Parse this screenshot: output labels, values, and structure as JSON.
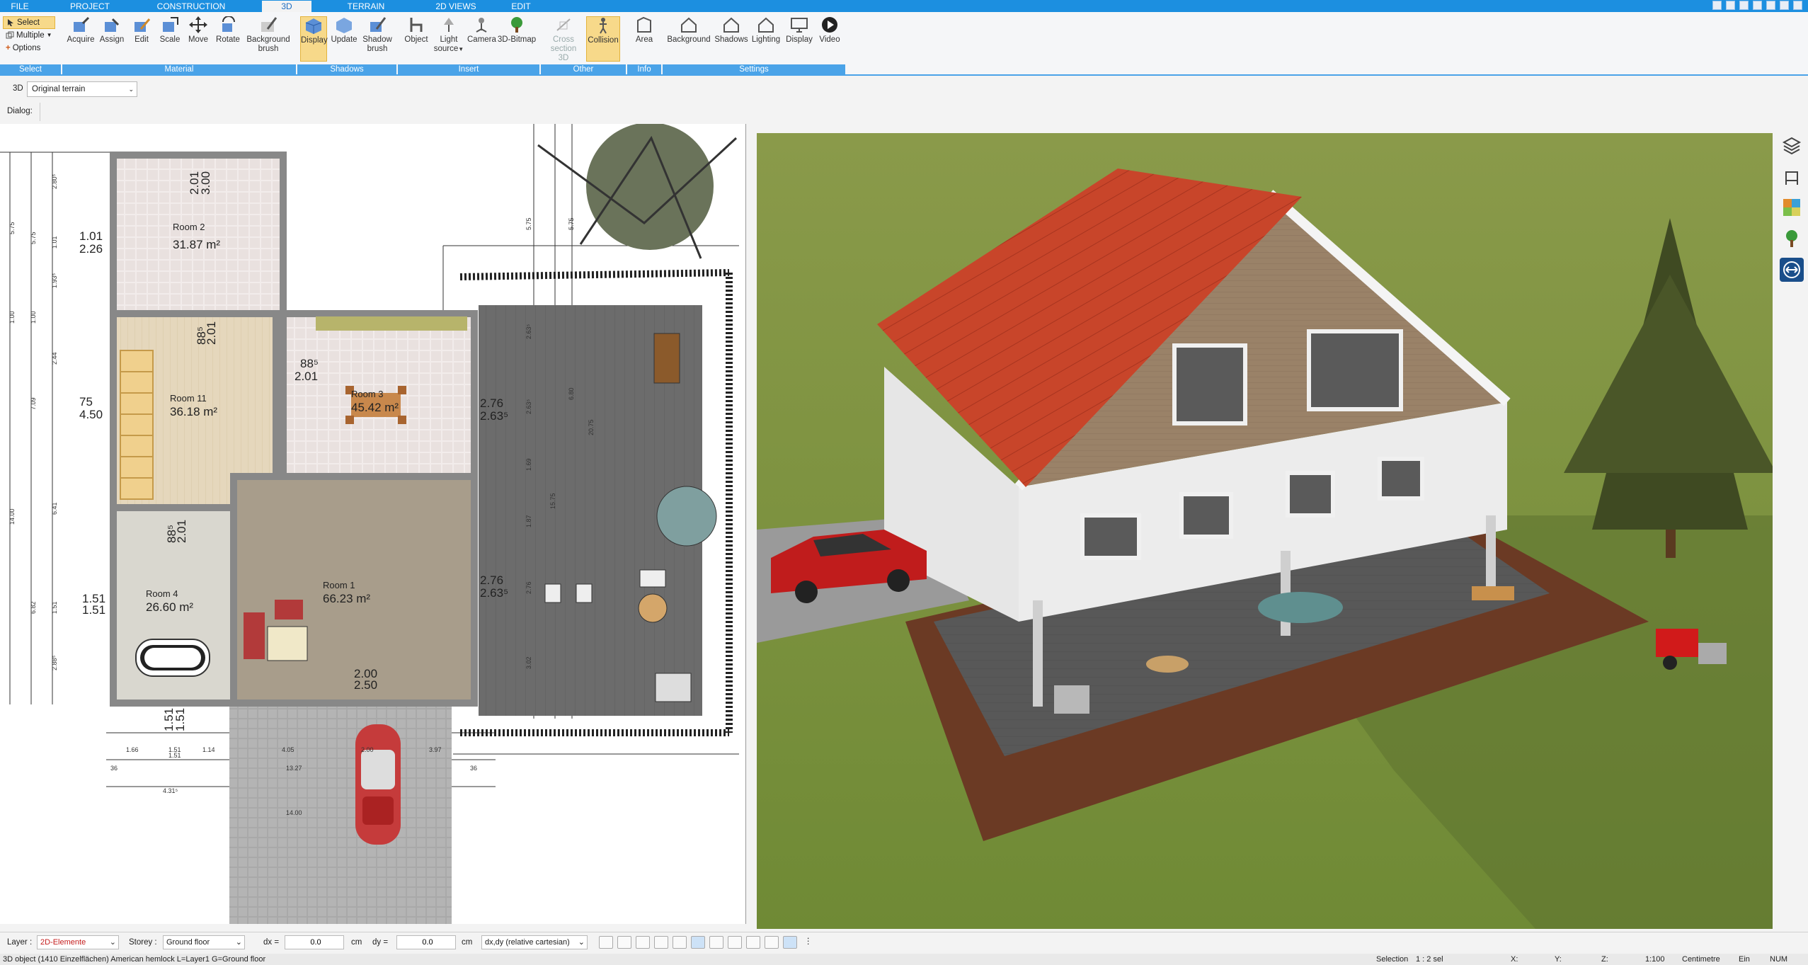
{
  "menu_tabs": [
    "FILE",
    "PROJECT",
    "CONSTRUCTION",
    "3D",
    "TERRAIN",
    "2D VIEWS",
    "EDIT"
  ],
  "active_tab": "3D",
  "ribbon": {
    "select_group": {
      "select": "Select",
      "multiple": "Multiple",
      "options": "Options",
      "label": "Select"
    },
    "material": {
      "label": "Material",
      "buttons": [
        "Acquire",
        "Assign",
        "Edit",
        "Scale",
        "Move",
        "Rotate",
        "Background brush"
      ]
    },
    "shadows": {
      "label": "Shadows",
      "buttons": [
        "Display",
        "Update",
        "Shadow brush"
      ]
    },
    "insert": {
      "label": "Insert",
      "buttons": [
        "Object",
        "Light source",
        "Camera",
        "3D-Bitmap"
      ]
    },
    "other": {
      "label": "Other",
      "buttons": [
        "Cross section 3D",
        "Collision"
      ]
    },
    "info": {
      "label": "Info",
      "buttons": [
        "Area"
      ]
    },
    "settings": {
      "label": "Settings",
      "buttons": [
        "Background",
        "Shadows",
        "Lighting",
        "Display",
        "Video"
      ]
    }
  },
  "subbar": {
    "mode": "3D",
    "terrain": "Original terrain",
    "dialog": "Dialog:"
  },
  "plan": {
    "rooms": [
      {
        "name": "Room 2",
        "area": "31.87 m²"
      },
      {
        "name": "Room 11",
        "area": "36.18 m²"
      },
      {
        "name": "Room 3",
        "area": "45.42 m²"
      },
      {
        "name": "Room 4",
        "area": "26.60 m²"
      },
      {
        "name": "Room 1",
        "area": "66.23 m²"
      }
    ],
    "dims": {
      "d1": "1.01",
      "d2": "2.26",
      "d3": "75",
      "d4": "4.50",
      "d5": "1.51",
      "d6": "1.51",
      "d7": "2.01",
      "d8": "3.00",
      "d9": "88⁵",
      "d10": "2.01",
      "d11": "88⁵",
      "d12": "2.01",
      "d13": "2.76",
      "d14": "2.63⁵",
      "d15": "2.76",
      "d16": "2.63⁵",
      "d17": "88⁵",
      "d18": "2.01",
      "d19": "2.00",
      "d20": "2.50",
      "d21": "1.51",
      "d22": "1.51",
      "d23": "2.00",
      "b1": "1.66",
      "b2": "1.51",
      "b3": "1.51",
      "b4": "1.14",
      "b5": "4.05",
      "b6": "3.97",
      "b7": "13.27",
      "b8": "4.31⁵",
      "b9": "14.00",
      "b10": "36",
      "b11": "36",
      "v1": "5.75",
      "v2": "5.75",
      "v3": "2.80⁵",
      "v4": "1.01",
      "v5": "1.93⁵",
      "v6": "1.00",
      "v7": "1.00",
      "v8": "2.44",
      "v9": "7.09",
      "v10": "6.41",
      "v11": "14.00",
      "v12": "6.82",
      "v13": "1.51",
      "v14": "2.88⁵",
      "t1": "5.75",
      "t2": "5.75",
      "t3": "2.63⁵",
      "t4": "6.80",
      "t5": "20.75",
      "t6": "1.69",
      "t7": "1.87",
      "t8": "2.76",
      "t9": "3.02",
      "t10": "15.75",
      "t11": "2.63⁵"
    }
  },
  "status": {
    "layer_label": "Layer :",
    "layer_value": "2D-Elemente",
    "storey_label": "Storey :",
    "storey_value": "Ground floor",
    "dx_label": "dx =",
    "dx_value": "0.0",
    "dx_unit": "cm",
    "dy_label": "dy =",
    "dy_value": "0.0",
    "dy_unit": "cm",
    "coord_mode": "dx,dy (relative cartesian)"
  },
  "statusbar": {
    "info": "3D object (1410 Einzelflächen) American hemlock L=Layer1 G=Ground floor",
    "selection_label": "Selection",
    "selection_value": "1 : 2 sel",
    "x": "X:",
    "y": "Y:",
    "z": "Z:",
    "scale": "1:100",
    "unit": "Centimetre",
    "ein": "Ein",
    "num": "NUM"
  },
  "colors": {
    "accent": "#1c8fe0",
    "ribbon_group": "#4aa3e8",
    "active_button": "#f7d98a",
    "roof": "#c8452a",
    "grass": "#7a8f3d"
  }
}
